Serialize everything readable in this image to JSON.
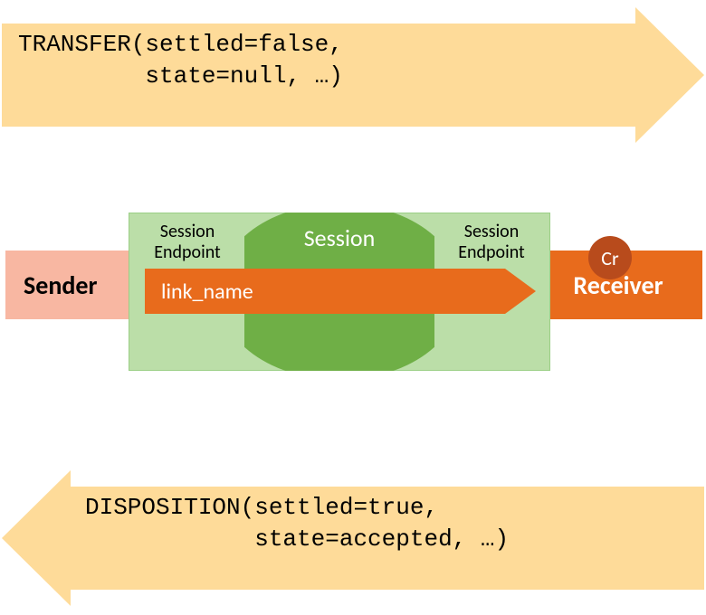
{
  "transfer": {
    "line1": "TRANSFER(settled=false,",
    "line2": "         state=null, …)"
  },
  "disposition": {
    "line1": "DISPOSITION(settled=true,",
    "line2": "            state=accepted, …)"
  },
  "middle": {
    "sender": "Sender",
    "receiver": "Receiver",
    "session_endpoint_left_l1": "Session",
    "session_endpoint_left_l2": "Endpoint",
    "session_endpoint_right_l1": "Session",
    "session_endpoint_right_l2": "Endpoint",
    "session_label": "Session",
    "link_name": "link_name",
    "cr": "Cr"
  },
  "colors": {
    "arrow_bg": "#FEDB99",
    "sender_bg": "#F8B7A2",
    "receiver_bg": "#E86B1C",
    "session_light": "#BBDEA8",
    "session_dark": "#6FAF46",
    "link_bg": "#E86B1C",
    "cr_bg": "#B84B1C"
  }
}
